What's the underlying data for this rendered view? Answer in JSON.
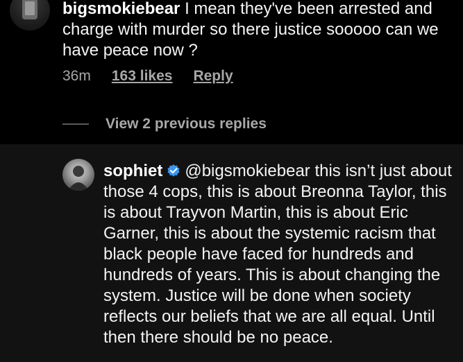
{
  "comment_1": {
    "username": "bigsmokiebear",
    "text": " I mean they've been arrested and charge with murder so there justice sooooo can we have peace now ?",
    "time": "36m",
    "likes": "163 likes",
    "reply_label": "Reply"
  },
  "view_replies": {
    "label": "View 2 previous replies"
  },
  "comment_2": {
    "username": "sophiet",
    "text": "@bigsmokiebear this isn’t just about those 4 cops, this is about Breonna Taylor, this is about Trayvon Martin, this is about Eric Garner, this is about the systemic racism that black people have faced for hundreds and hundreds of years. This is about changing the system. Justice will be done when society reflects our beliefs that we are all equal. Until then there should be no peace."
  },
  "icons": {
    "verified": "verified-badge-icon",
    "accent": "#3897f0"
  }
}
